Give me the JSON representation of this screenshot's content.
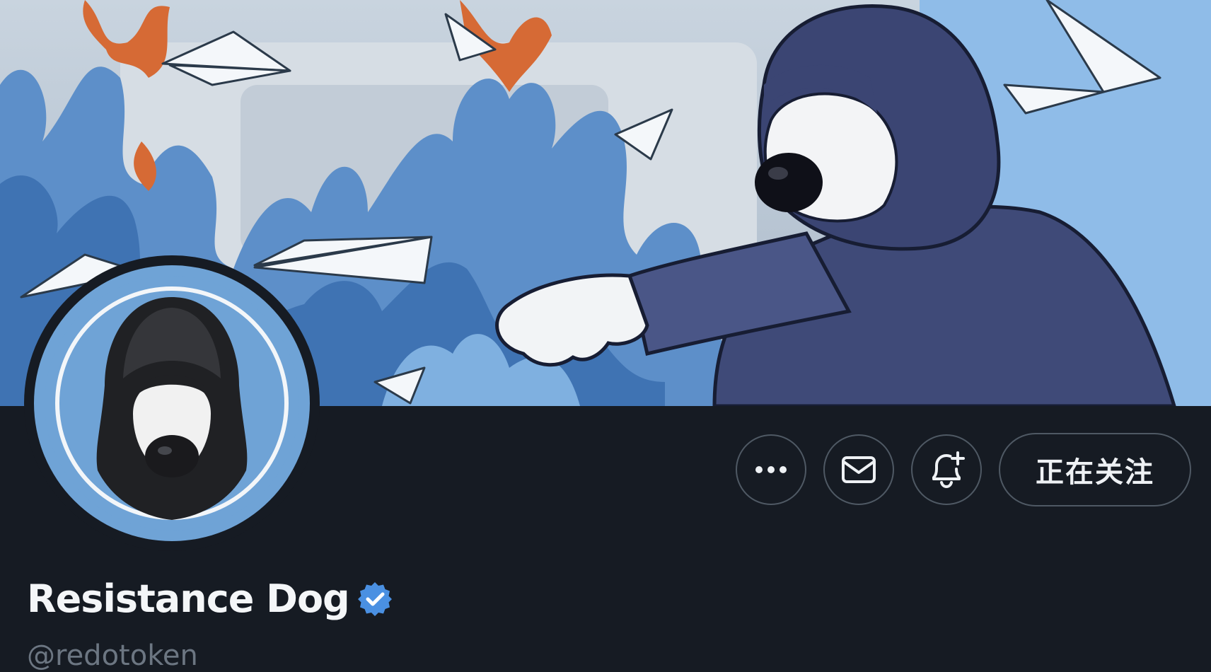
{
  "profile": {
    "display_name": "Resistance Dog",
    "handle": "@redotoken",
    "verified": true,
    "verified_icon": "verified-badge-icon"
  },
  "banner": {
    "description_icon": "banner-image",
    "scene_icons": [
      "paper-plane-icon",
      "flame-icon",
      "hooded-dog-icon",
      "raised-fist-icon"
    ]
  },
  "avatar": {
    "icon": "hooded-dog-avatar-icon"
  },
  "actions": {
    "more_icon": "more-dots-icon",
    "message_icon": "mail-icon",
    "notify_icon": "bell-plus-icon",
    "follow_label": "正在关注"
  },
  "colors": {
    "background": "#161b23",
    "verified": "#4a90e2",
    "handle": "#6c7682",
    "button_border": "#4f5964"
  }
}
